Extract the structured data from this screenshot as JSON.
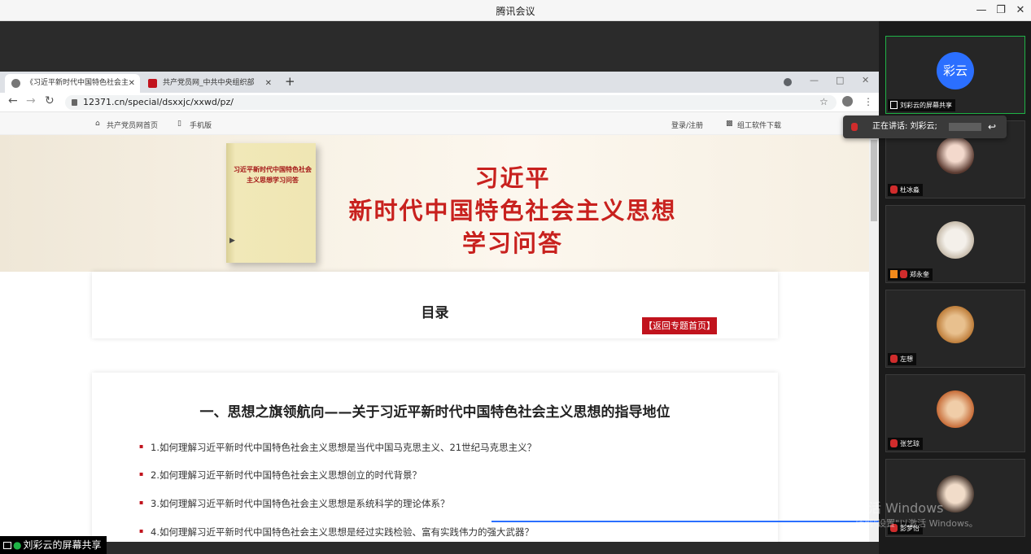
{
  "window": {
    "title": "腾讯会议"
  },
  "browser": {
    "tabs": [
      {
        "label": "《习近平新时代中国特色社会主"
      },
      {
        "label": "共产党员网_中共中央组织部"
      }
    ],
    "url": "12371.cn/special/dsxxjc/xxwd/pz/"
  },
  "site": {
    "home_link": "共产党员网首页",
    "mobile_link": "手机版",
    "login_link": "登录/注册",
    "download_link": "组工软件下载"
  },
  "banner": {
    "book_title": "习近平新时代中国特色社会主义思想学习问答",
    "title_line1": "习近平",
    "title_line2": "新时代中国特色社会主义思想",
    "title_line3": "学习问答"
  },
  "toc": {
    "title": "目录",
    "back_button": "【返回专题首页】"
  },
  "section": {
    "heading": "一、思想之旗领航向——关于习近平新时代中国特色社会主义思想的指导地位",
    "questions": [
      "1.如何理解习近平新时代中国特色社会主义思想是当代中国马克思主义、21世纪马克思主义？",
      "2.如何理解习近平新时代中国特色社会主义思想创立的时代背景？",
      "3.如何理解习近平新时代中国特色社会主义思想是系统科学的理论体系？",
      "4.如何理解习近平新时代中国特色社会主义思想是经过实践检验、富有实践伟力的强大武器？"
    ]
  },
  "screen_share_label": "刘彩云的屏幕共享",
  "participants": [
    {
      "name": "刘彩云的屏幕共享",
      "avatar_text": "彩云"
    },
    {
      "name": "杜冰淼"
    },
    {
      "name": "郑永奎"
    },
    {
      "name": "左想"
    },
    {
      "name": "张艺琼"
    },
    {
      "name": "彭梦怡"
    }
  ],
  "speaking": {
    "label": "正在讲话: 刘彩云;"
  },
  "watermark": {
    "line1": "激活 Windows",
    "line2": "转到\"设置\"以激活 Windows。"
  },
  "colors": {
    "accent_red": "#c1131d",
    "avatar_blue": "#2b6fff",
    "speaking_green": "#1fb346"
  }
}
